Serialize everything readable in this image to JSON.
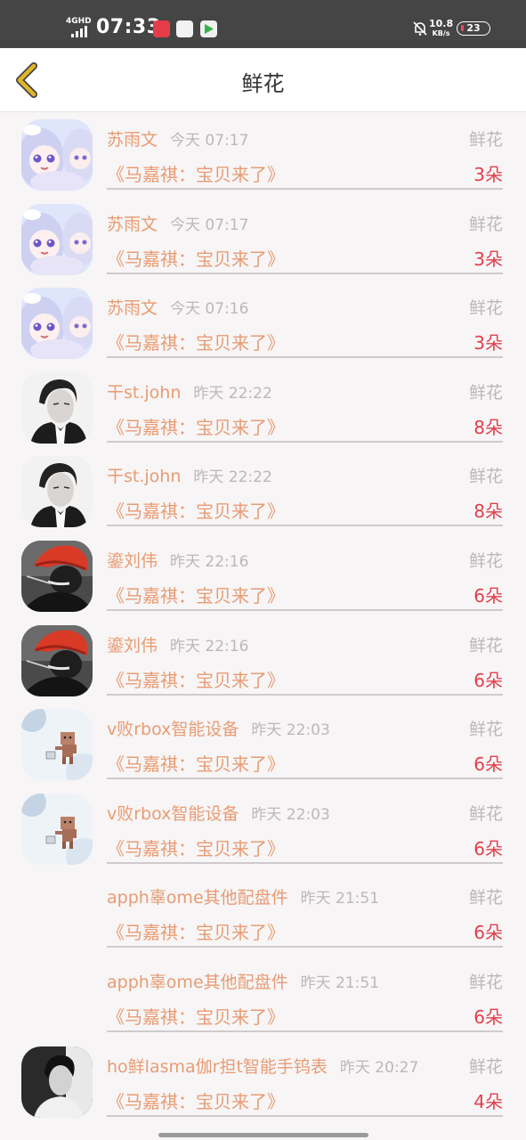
{
  "status_bar": {
    "network": "4GHD",
    "time": "07:33",
    "speed_value": "10.8",
    "speed_unit": "KB/s",
    "battery": "23"
  },
  "header": {
    "title": "鲜花"
  },
  "records": [
    {
      "user": "苏雨文",
      "time": "今天 07:17",
      "type": "鲜花",
      "title": "《马嘉祺：宝贝来了》",
      "count": "3朵",
      "avatar": "anime-girl-avatar"
    },
    {
      "user": "苏雨文",
      "time": "今天 07:17",
      "type": "鲜花",
      "title": "《马嘉祺：宝贝来了》",
      "count": "3朵",
      "avatar": "anime-girl-avatar"
    },
    {
      "user": "苏雨文",
      "time": "今天 07:16",
      "type": "鲜花",
      "title": "《马嘉祺：宝贝来了》",
      "count": "3朵",
      "avatar": "anime-girl-avatar"
    },
    {
      "user": "干st.john",
      "time": "昨天 22:22",
      "type": "鲜花",
      "title": "《马嘉祺：宝贝来了》",
      "count": "8朵",
      "avatar": "man-portrait-avatar"
    },
    {
      "user": "干st.john",
      "time": "昨天 22:22",
      "type": "鲜花",
      "title": "《马嘉祺：宝贝来了》",
      "count": "8朵",
      "avatar": "man-portrait-avatar"
    },
    {
      "user": "鎏刘伟",
      "time": "昨天 22:16",
      "type": "鲜花",
      "title": "《马嘉祺：宝贝来了》",
      "count": "6朵",
      "avatar": "red-hat-avatar"
    },
    {
      "user": "鎏刘伟",
      "time": "昨天 22:16",
      "type": "鲜花",
      "title": "《马嘉祺：宝贝来了》",
      "count": "6朵",
      "avatar": "red-hat-avatar"
    },
    {
      "user": "v败rbox智能设备",
      "time": "昨天 22:03",
      "type": "鲜花",
      "title": "《马嘉祺：宝贝来了》",
      "count": "6朵",
      "avatar": "cardboard-robot-avatar"
    },
    {
      "user": "v败rbox智能设备",
      "time": "昨天 22:03",
      "type": "鲜花",
      "title": "《马嘉祺：宝贝来了》",
      "count": "6朵",
      "avatar": "cardboard-robot-avatar"
    },
    {
      "user": "apph辜ome其他配盘件",
      "time": "昨天 21:51",
      "type": "鲜花",
      "title": "《马嘉祺：宝贝来了》",
      "count": "6朵",
      "avatar": "none"
    },
    {
      "user": "apph辜ome其他配盘件",
      "time": "昨天 21:51",
      "type": "鲜花",
      "title": "《马嘉祺：宝贝来了》",
      "count": "6朵",
      "avatar": "none"
    },
    {
      "user": "ho鲜lasma伽r担t智能手钨表",
      "time": "昨天 20:27",
      "type": "鲜花",
      "title": "《马嘉祺：宝贝来了》",
      "count": "4朵",
      "avatar": "bw-portrait-avatar"
    }
  ],
  "colors": {
    "accent_orange": "#e89c73",
    "count_red": "#e0404e",
    "muted_gray": "#bcb7b8",
    "back_arrow": "#e2b62c"
  }
}
